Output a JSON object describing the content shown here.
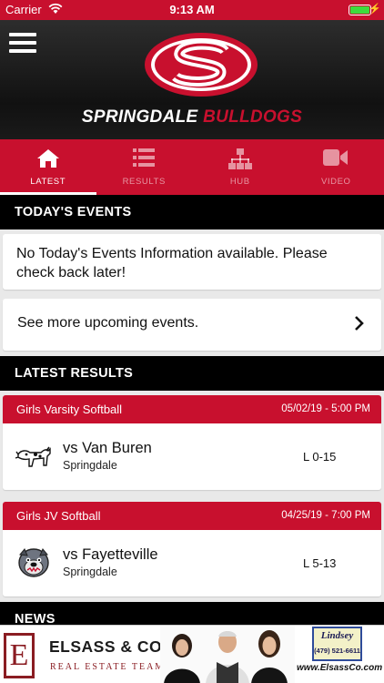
{
  "status": {
    "carrier": "Carrier",
    "time": "9:13 AM"
  },
  "header": {
    "brand_word1": "SPRINGDALE",
    "brand_word2": "BULLDOGS",
    "logo_letter": "S"
  },
  "tabs": [
    {
      "label": "LATEST",
      "icon": "home-icon",
      "active": true
    },
    {
      "label": "RESULTS",
      "icon": "list-icon",
      "active": false
    },
    {
      "label": "HUB",
      "icon": "hub-icon",
      "active": false
    },
    {
      "label": "VIDEO",
      "icon": "video-icon",
      "active": false
    }
  ],
  "todays_events": {
    "title": "TODAY'S EVENTS",
    "empty_message": "No Today's Events Information available. Please check back later!",
    "more_link": "See more upcoming events."
  },
  "latest_results": {
    "title": "LATEST RESULTS",
    "items": [
      {
        "sport": "Girls Varsity Softball",
        "date": "05/02/19 - 5:00 PM",
        "opponent": "vs Van Buren",
        "home_team": "Springdale",
        "score": "L 0-15",
        "mascot_icon": "pointer-dog-icon"
      },
      {
        "sport": "Girls JV Softball",
        "date": "04/25/19 - 7:00 PM",
        "opponent": "vs Fayetteville",
        "home_team": "Springdale",
        "score": "L 5-13",
        "mascot_icon": "bulldog-icon"
      }
    ]
  },
  "news": {
    "title": "NEWS"
  },
  "ad": {
    "logo_letter": "E",
    "company": "ELSASS & CO.",
    "tagline": "REAL ESTATE TEAM",
    "partner_name": "Lindsey",
    "partner_phone": "(479) 521-6611",
    "url": "www.ElsassCo.com"
  },
  "colors": {
    "brand_red": "#c8102e",
    "black": "#000000",
    "battery_green": "#3ddc3d"
  }
}
